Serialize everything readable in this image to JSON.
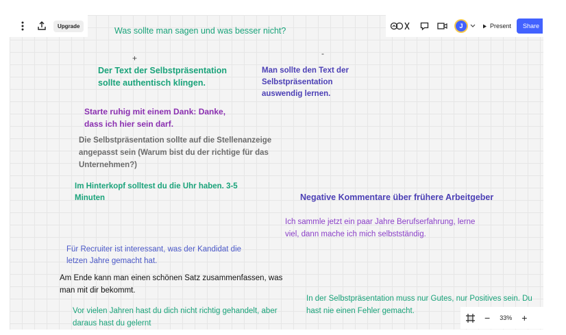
{
  "toolbar": {
    "upgrade_label": "Upgrade"
  },
  "header_note": "Was sollte man sagen und was besser nicht?",
  "plus_mark": "+",
  "minus_mark": "-",
  "notes": {
    "n1": "Der Text der Selbstpräsentation sollte authentisch klingen.",
    "n2": "Man sollte den Text  der Selbstpräsentation auswendig lernen.",
    "n3": "Starte ruhig mit einem Dank: Danke, dass ich hier sein darf.",
    "n4": "Die Selbstpräsentation sollte auf die Stellenanzeige angepasst sein (Warum bist du der richtige für das Unternehmen?)",
    "n5": "Im Hinterkopf solltest du die Uhr haben. 3-5 Minuten",
    "n6": "Negative Kommentare über frühere Arbeitgeber",
    "n7": "Ich sammle jetzt ein paar Jahre Berufserfahrung, lerne viel, dann mache ich mich selbstständig.",
    "n8": "Für Recruiter ist interessant, was der Kandidat die letzen Jahre gemacht hat.",
    "n9": "Am Ende kann man einen schönen Satz zusammenfassen, was man mit dir bekommt.",
    "n10": "In der Selbstpräsentation muss nur Gutes, nur Positives sein. Du hast nie einen Fehler gemacht.",
    "n11": "Vor vielen Jahren hast du dich nicht richtig gehandelt, aber daraus hast du gelernt"
  },
  "top_right": {
    "avatar_initial": "J",
    "present_label": "Present",
    "share_label": "Share"
  },
  "zoom": {
    "level": "33%"
  },
  "colors": {
    "teal": "#1aa37a",
    "blue_purple": "#4b3fb5",
    "purple": "#8a2fb0",
    "gray": "#6b6b6b",
    "light_blue": "#4a58c8",
    "accent": "#4262ff"
  }
}
